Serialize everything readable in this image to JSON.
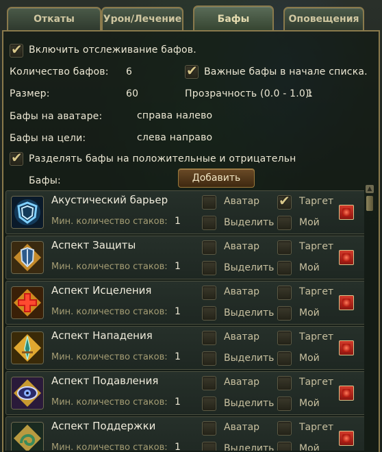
{
  "tabs": [
    {
      "label": "Откаты"
    },
    {
      "label": "Урон/Лечение"
    },
    {
      "label": "Бафы"
    },
    {
      "label": "Оповещения"
    }
  ],
  "settings": {
    "enable_label": "Включить отслеживание бафов.",
    "enable_checked": true,
    "count_label": "Количество бафов:",
    "count_value": "6",
    "important_label": "Важные бафы в начале списка.",
    "important_checked": true,
    "size_label": "Размер:",
    "size_value": "60",
    "opacity_label": "Прозрачность (0.0 - 1.0):",
    "opacity_value": "1",
    "avatar_buffs_label": "Бафы на аватаре:",
    "avatar_buffs_value": "справа налево",
    "target_buffs_label": "Бафы на цели:",
    "target_buffs_value": "слева направо",
    "split_label": "Разделять бафы на положительные и отрицательн",
    "split_checked": true,
    "buffs_label": "Бафы:",
    "add_button": "Добавить"
  },
  "item_labels": {
    "min_stacks": "Мин. количество стаков:",
    "avatar": "Аватар",
    "target": "Таргет",
    "highlight": "Выделить",
    "mine": "Мой"
  },
  "buffs": [
    {
      "name": "Акустический барьер",
      "icon": "acoustic-barrier-icon",
      "stacks": "1",
      "avatar": false,
      "target": true,
      "highlight": false,
      "mine": false
    },
    {
      "name": "Аспект Защиты",
      "icon": "shield-aspect-icon",
      "stacks": "1",
      "avatar": false,
      "target": false,
      "highlight": false,
      "mine": false
    },
    {
      "name": "Аспект Исцеления",
      "icon": "red-cross-icon",
      "stacks": "1",
      "avatar": false,
      "target": false,
      "highlight": false,
      "mine": false
    },
    {
      "name": "Аспект Нападения",
      "icon": "sword-aspect-icon",
      "stacks": "1",
      "avatar": false,
      "target": false,
      "highlight": false,
      "mine": false
    },
    {
      "name": "Аспект Подавления",
      "icon": "eye-aspect-icon",
      "stacks": "1",
      "avatar": false,
      "target": false,
      "highlight": false,
      "mine": false
    },
    {
      "name": "Аспект Поддержки",
      "icon": "support-aspect-icon",
      "stacks": "1",
      "avatar": false,
      "target": false,
      "highlight": false,
      "mine": false
    }
  ]
}
